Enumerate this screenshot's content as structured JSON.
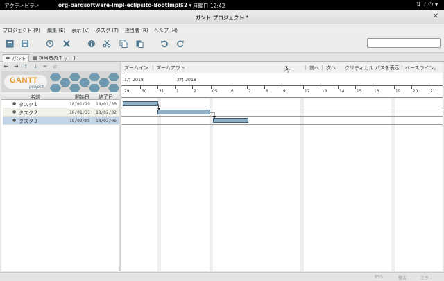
{
  "system_bar": {
    "activities": "アクティビティ",
    "app_menu": "org-bardsoftware-impl-eclipsito-BootImpl$2",
    "clock": "月曜日  12:42"
  },
  "window": {
    "title": "ガント プロジェクト *"
  },
  "menu": [
    "プロジェクト (P)",
    "編集 (E)",
    "表示 (V)",
    "タスク (T)",
    "担当者 (R)",
    "ヘルプ (H)"
  ],
  "tabs": {
    "gantt": "ガント",
    "resources": "担当者のチャート"
  },
  "logo": {
    "name": "GANTT",
    "sub": "project"
  },
  "task_table": {
    "columns": {
      "name": "名前",
      "start": "開始日",
      "end": "終了日"
    },
    "rows": [
      {
        "name": "タスク１",
        "start": "18/01/29",
        "end": "18/01/30",
        "selected": false
      },
      {
        "name": "タスク２",
        "start": "18/01/31",
        "end": "18/02/02",
        "selected": false
      },
      {
        "name": "タスク３",
        "start": "18/02/05",
        "end": "18/02/06",
        "selected": true
      }
    ]
  },
  "chart_nav": {
    "zoom_in": "ズームイン",
    "zoom_out": "ズームアウト",
    "today": "今日",
    "prev": "前へ",
    "next": "次へ",
    "critical_path": "クリティカル パスを表示",
    "baseline": "ベースライン。"
  },
  "timeline": {
    "months": [
      "1月 2018",
      "2月 2018"
    ],
    "days": [
      "29",
      "30",
      "31",
      "1",
      "2",
      "05",
      "6",
      "7",
      "8",
      "9",
      "12",
      "13",
      "14",
      "15",
      "16",
      "19",
      "20",
      "21"
    ]
  },
  "status": {
    "rss": "RSS",
    "warning": "警告",
    "error": "エラー"
  }
}
